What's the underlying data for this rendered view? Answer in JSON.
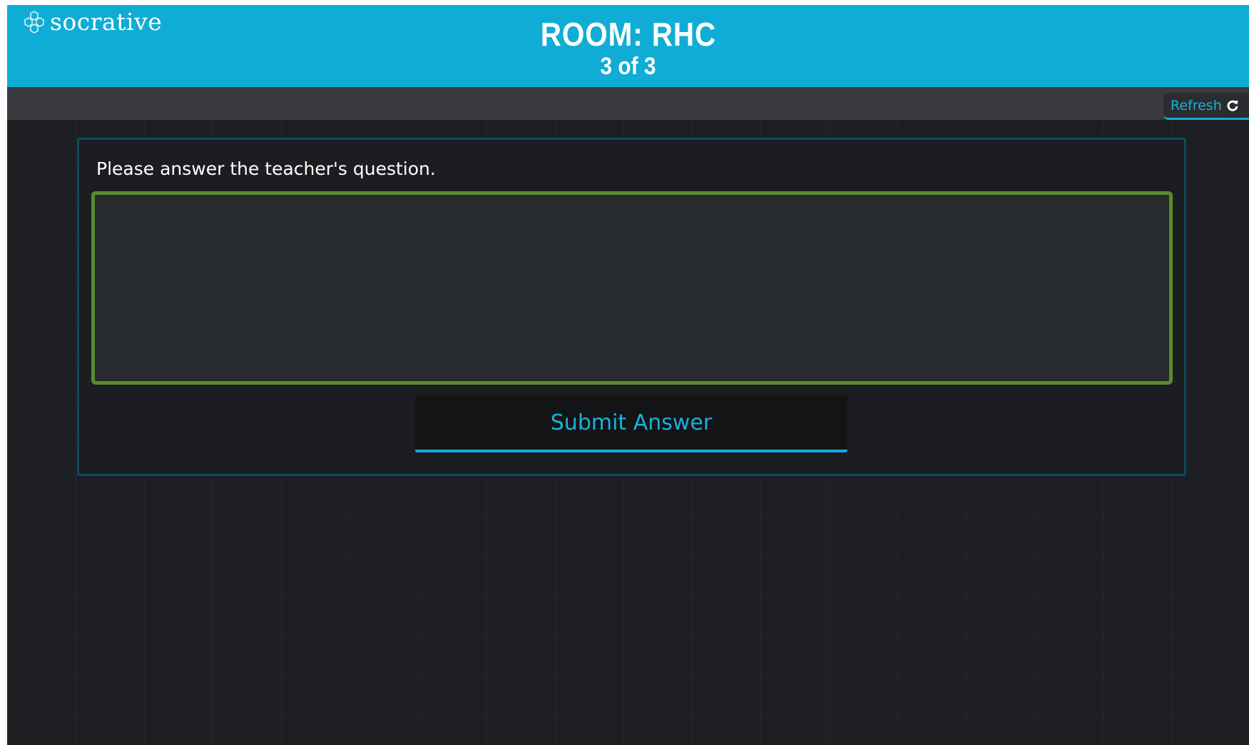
{
  "brand": {
    "name": "socrative",
    "icon": "hexagon-cluster-icon"
  },
  "header": {
    "room_title": "ROOM: RHC",
    "progress": "3 of 3"
  },
  "toolbar": {
    "refresh_label": "Refresh",
    "refresh_icon": "refresh-icon"
  },
  "question": {
    "prompt": "Please answer the teacher's question.",
    "answer_value": "",
    "submit_label": "Submit Answer"
  },
  "colors": {
    "header": "#0fadd5",
    "accent": "#17aad4",
    "input_border": "#5a8b2d",
    "background": "#1e1f22"
  }
}
